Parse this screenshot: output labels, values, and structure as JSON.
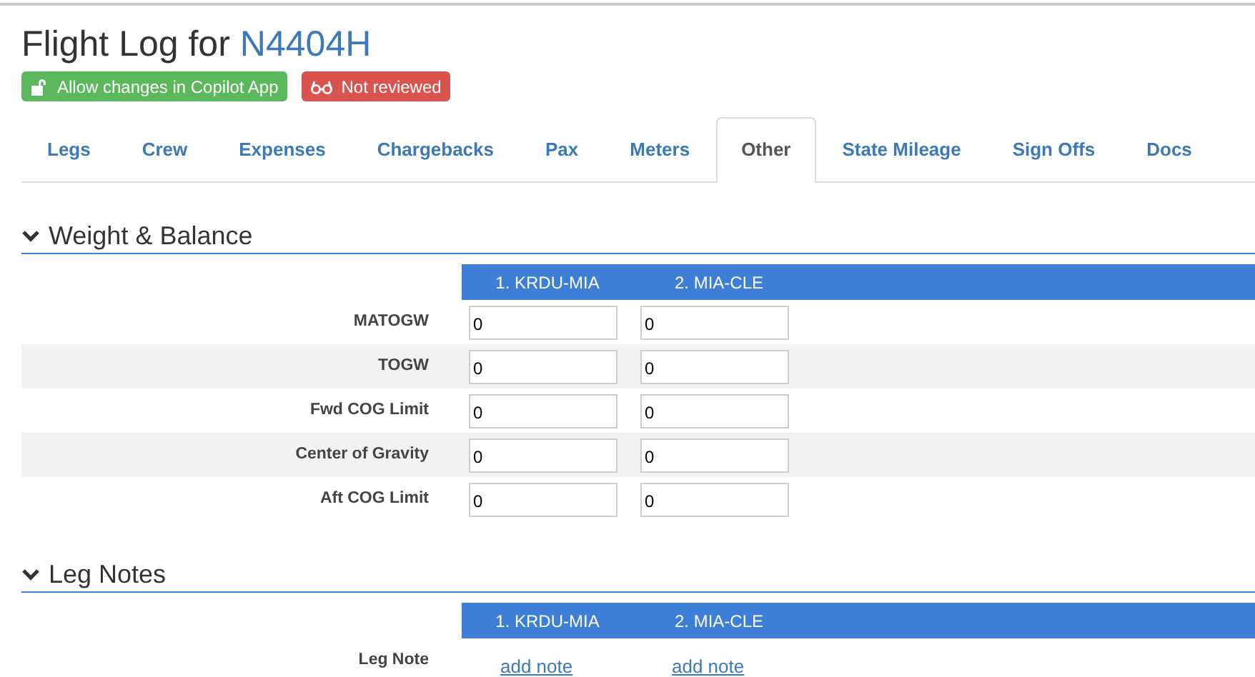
{
  "header": {
    "title": "Flight Log for",
    "tail_number": "N4404H"
  },
  "badges": [
    {
      "kind": "unlocked",
      "label": "Allow changes in Copilot App"
    },
    {
      "kind": "review",
      "label": "Not reviewed"
    }
  ],
  "tabs": [
    {
      "label": "Legs",
      "selected": false
    },
    {
      "label": "Crew",
      "selected": false
    },
    {
      "label": "Expenses",
      "selected": false
    },
    {
      "label": "Chargebacks",
      "selected": false
    },
    {
      "label": "Pax",
      "selected": false
    },
    {
      "label": "Meters",
      "selected": false
    },
    {
      "label": "Other",
      "selected": true
    },
    {
      "label": "State Mileage",
      "selected": false
    },
    {
      "label": "Sign Offs",
      "selected": false
    },
    {
      "label": "Docs",
      "selected": false
    }
  ],
  "sections": [
    {
      "title": "Weight & Balance",
      "expanded": true,
      "kind": "inputs",
      "columns": [
        "1. KRDU-MIA",
        "2. MIA-CLE"
      ],
      "rows": [
        {
          "label": "MATOGW",
          "values": [
            "0",
            "0"
          ]
        },
        {
          "label": "TOGW",
          "values": [
            "0",
            "0"
          ]
        },
        {
          "label": "Fwd COG Limit",
          "values": [
            "0",
            "0"
          ]
        },
        {
          "label": "Center of Gravity",
          "values": [
            "0",
            "0"
          ]
        },
        {
          "label": "Aft COG Limit",
          "values": [
            "0",
            "0"
          ]
        }
      ]
    },
    {
      "title": "Leg Notes",
      "expanded": true,
      "kind": "links",
      "columns": [
        "1. KRDU-MIA",
        "2. MIA-CLE"
      ],
      "rows": [
        {
          "label": "Leg Note",
          "values": [
            "add note",
            "add note"
          ]
        }
      ]
    }
  ]
}
